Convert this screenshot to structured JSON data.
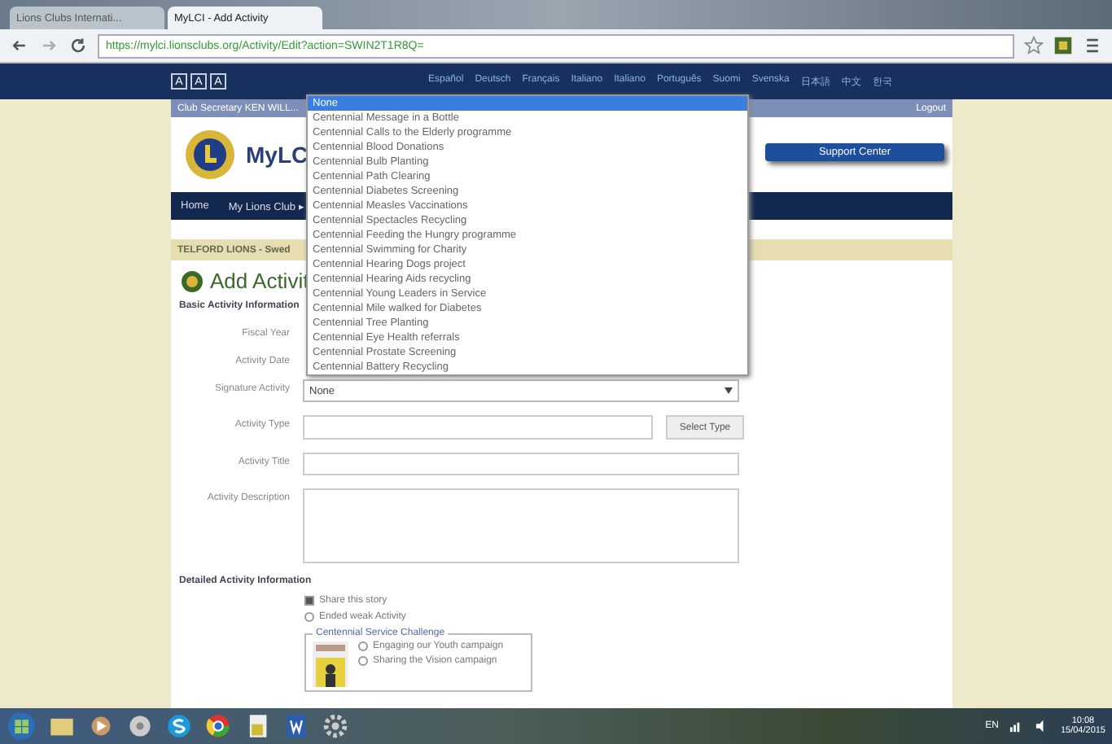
{
  "browser": {
    "tabs": [
      {
        "title": "Lions Clubs Internati...",
        "selected": false
      },
      {
        "title": "MyLCI - Add Activity",
        "selected": true
      }
    ],
    "url": "https://mylci.lionsclubs.org/Activity/Edit?action=SWIN2T1R8Q="
  },
  "site": {
    "font_sizes": [
      "A",
      "A",
      "A"
    ],
    "languages": [
      "Español",
      "Deutsch",
      "Français",
      "Italiano",
      "Italiano",
      "Português",
      "Suomi",
      "Svenska",
      "日本語",
      "中文",
      "한국"
    ],
    "account": "Club Secretary KEN WILL...",
    "logout": "Logout",
    "logo_text": "MyLC",
    "support_button": "Support Center",
    "nav": [
      "Home",
      "My Lions Club ▸"
    ],
    "breadcrumb": "TELFORD LIONS - Swed",
    "heading": "Add Activit"
  },
  "form": {
    "section_title": "Basic Activity Information",
    "fields": [
      {
        "kind": "text",
        "label": "Fiscal Year"
      },
      {
        "kind": "text",
        "label": "Activity Date"
      },
      {
        "kind": "select",
        "label": "Signature Activity",
        "value": "None"
      },
      {
        "kind": "input_button",
        "label": "Activity Type",
        "button": "Select Type"
      },
      {
        "kind": "input",
        "label": "Activity Title"
      },
      {
        "kind": "textarea",
        "label": "Activity Description"
      }
    ]
  },
  "dropdown": {
    "options": [
      {
        "label": "None",
        "selected": true
      },
      {
        "label": "Centennial Message in a Bottle",
        "selected": false
      },
      {
        "label": "Centennial Calls to the Elderly programme",
        "selected": false
      },
      {
        "label": "Centennial Blood Donations",
        "selected": false
      },
      {
        "label": "Centennial Bulb Planting",
        "selected": false
      },
      {
        "label": "Centennial Path Clearing",
        "selected": false
      },
      {
        "label": "Centennial Diabetes Screening",
        "selected": false
      },
      {
        "label": "Centennial Measles Vaccinations",
        "selected": false
      },
      {
        "label": "Centennial Spectacles Recycling",
        "selected": false
      },
      {
        "label": "Centennial Feeding the Hungry programme",
        "selected": false
      },
      {
        "label": "Centennial Swimming for Charity",
        "selected": false
      },
      {
        "label": "Centennial Hearing Dogs project",
        "selected": false
      },
      {
        "label": "Centennial Hearing Aids recycling",
        "selected": false
      },
      {
        "label": "Centennial Young Leaders in Service",
        "selected": false
      },
      {
        "label": "Centennial Mile walked for Diabetes",
        "selected": false
      },
      {
        "label": "Centennial Tree Planting",
        "selected": false
      },
      {
        "label": "Centennial Eye Health referrals",
        "selected": false
      },
      {
        "label": "Centennial Prostate Screening",
        "selected": false
      },
      {
        "label": "Centennial Battery Recycling",
        "selected": false
      }
    ]
  },
  "detailed": {
    "title": "Detailed Activity Information",
    "options": [
      {
        "kind": "checkbox",
        "label": "Share this story",
        "checked": true
      },
      {
        "kind": "radio",
        "label": "Ended weak Activity",
        "checked": false
      }
    ],
    "challenge": {
      "legend": "Centennial Service Challenge",
      "options": [
        {
          "label": "Engaging our Youth campaign",
          "checked": false
        },
        {
          "label": "Sharing the Vision campaign",
          "checked": false
        }
      ]
    }
  },
  "taskbar": {
    "language": "EN",
    "time": "10:08",
    "date": "15/04/2015"
  }
}
